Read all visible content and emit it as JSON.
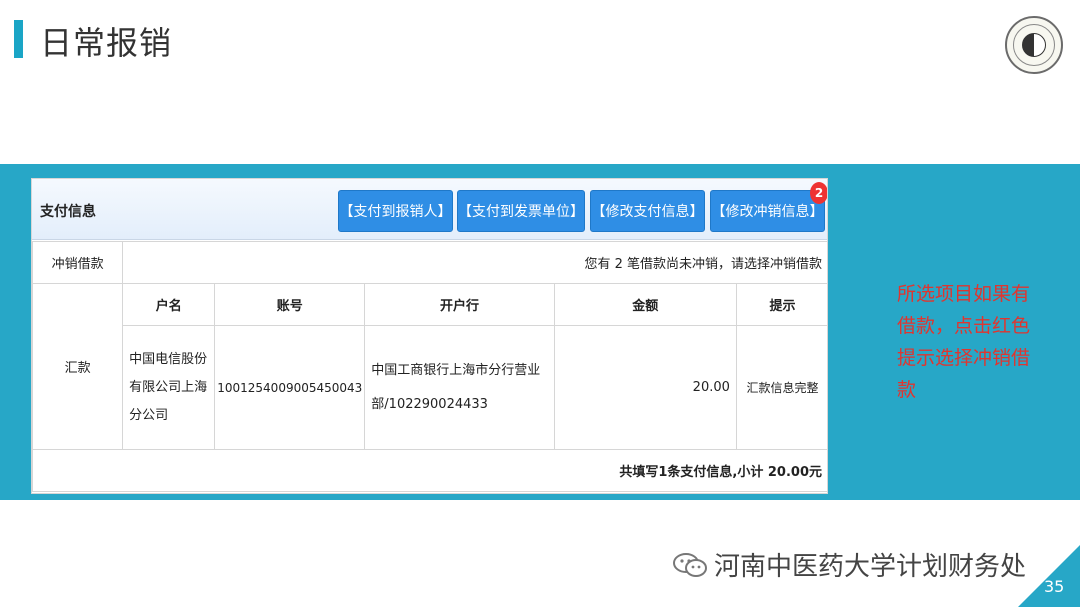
{
  "slide": {
    "title": "日常报销",
    "page_number": "35"
  },
  "panel": {
    "title": "支付信息",
    "buttons": [
      "【支付到报销人】",
      "【支付到发票单位】",
      "【修改支付信息】",
      "【修改冲销信息】"
    ],
    "badge_count": "2",
    "offset_row": {
      "label": "冲销借款",
      "message": "您有 2 笔借款尚未冲销，请选择冲销借款"
    },
    "remit": {
      "label": "汇款",
      "headers": [
        "户名",
        "账号",
        "开户行",
        "金额",
        "提示"
      ],
      "row": {
        "name": "中国电信股份有限公司上海分公司",
        "account": "1001254009005450043",
        "bank": "中国工商银行上海市分行营业部/102290024433",
        "amount": "20.00",
        "hint": "汇款信息完整"
      }
    },
    "summary": "共填写1条支付信息,小计 20.00元"
  },
  "annotation": "所选项目如果有借款，点击红色提示选择冲销借款",
  "footer": {
    "wechat_account": "河南中医药大学计划财务处"
  }
}
